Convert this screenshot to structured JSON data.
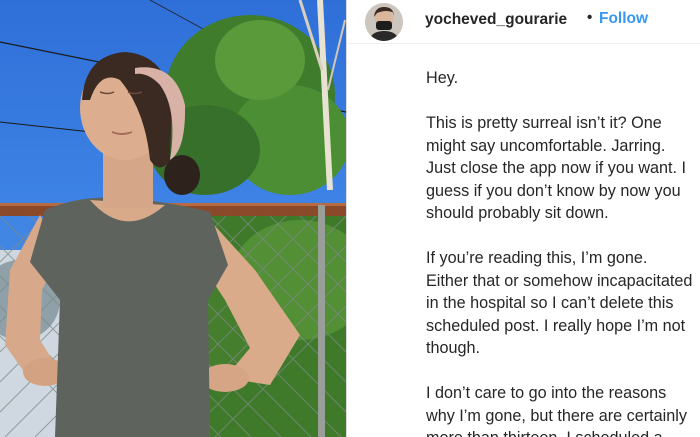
{
  "post": {
    "username": "yocheved_gourarie",
    "separator": "•",
    "follow_label": "Follow"
  },
  "caption": {
    "paragraphs": [
      [
        "Hey."
      ],
      [
        "This is pretty surreal isn’t it? One",
        "might say uncomfortable. Jarring.",
        "Just close the app now if you want. I",
        "guess if you don’t know by now you",
        "should probably sit down."
      ],
      [
        "If you’re reading this, I’m gone.",
        "Either that or somehow incapacitated",
        "in the hospital so I can’t delete this",
        "scheduled post. I really hope I’m not",
        "though."
      ],
      [
        "I don’t care to go into the reasons",
        "why I’m gone, but there are certainly",
        "more than thirteen. I scheduled a"
      ]
    ]
  },
  "icons": {
    "avatar": "profile-photo-masked",
    "photo": "post-photo"
  },
  "colors": {
    "text": "#262626",
    "follow": "#3897f0",
    "border": "#dbdbdb"
  }
}
